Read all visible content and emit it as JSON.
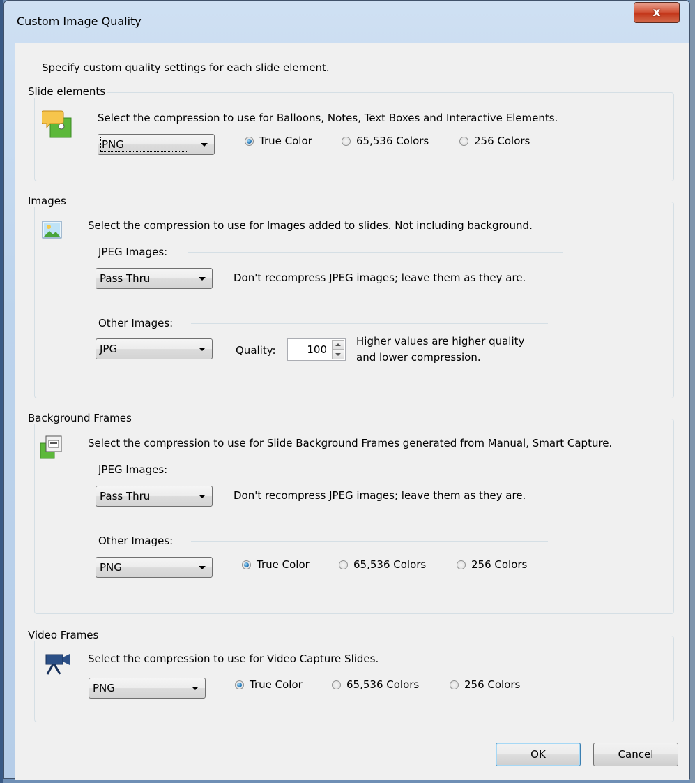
{
  "window": {
    "title": "Custom Image Quality",
    "close_glyph": "x"
  },
  "intro": "Specify custom quality settings for each slide element.",
  "slide_elements": {
    "title": "Slide elements",
    "description": "Select the compression to use for Balloons, Notes, Text Boxes and Interactive Elements.",
    "compression": "PNG",
    "radios": [
      {
        "label": "True Color",
        "selected": true
      },
      {
        "label": "65,536 Colors",
        "selected": false
      },
      {
        "label": "256 Colors",
        "selected": false
      }
    ],
    "icon": "balloon-note-icon"
  },
  "images": {
    "title": "Images",
    "description": "Select the compression to use for Images added to slides. Not including background.",
    "jpeg_label": "JPEG Images:",
    "jpeg_compression": "Pass Thru",
    "jpeg_note": "Don't recompress JPEG images; leave them as they are.",
    "other_label": "Other Images:",
    "other_compression": "JPG",
    "quality_label": "Quality:",
    "quality_value": "100",
    "quality_note_line1": "Higher values are higher quality",
    "quality_note_line2": "and lower compression.",
    "icon": "picture-icon"
  },
  "background_frames": {
    "title": "Background Frames",
    "description": "Select the compression to use for Slide Background Frames generated from Manual, Smart Capture.",
    "jpeg_label": "JPEG Images:",
    "jpeg_compression": "Pass Thru",
    "jpeg_note": "Don't recompress JPEG images; leave them as they are.",
    "other_label": "Other Images:",
    "other_compression": "PNG",
    "radios": [
      {
        "label": "True Color",
        "selected": true
      },
      {
        "label": "65,536 Colors",
        "selected": false
      },
      {
        "label": "256 Colors",
        "selected": false
      }
    ],
    "icon": "background-frames-icon"
  },
  "video_frames": {
    "title": "Video Frames",
    "description": "Select the compression to use for Video Capture Slides.",
    "compression": "PNG",
    "radios": [
      {
        "label": "True Color",
        "selected": true
      },
      {
        "label": "65,536 Colors",
        "selected": false
      },
      {
        "label": "256 Colors",
        "selected": false
      }
    ],
    "icon": "video-camera-icon"
  },
  "buttons": {
    "ok": "OK",
    "cancel": "Cancel"
  },
  "colors": {
    "title_bar": "#bcd3ec",
    "close_button": "#c3361a",
    "dialog_background": "#f0f0f0",
    "radio_selected": "#1b6fb1"
  }
}
